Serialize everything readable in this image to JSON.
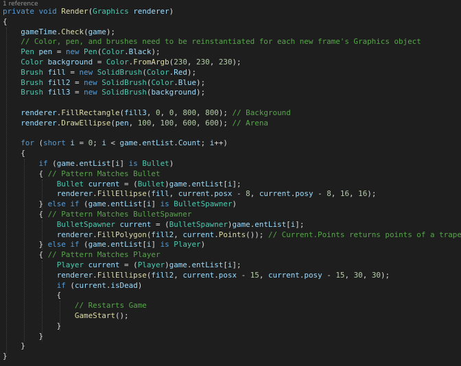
{
  "editor": {
    "codelens": "1 reference",
    "lines": [
      [
        [
          "private",
          "kw"
        ],
        [
          " ",
          "pl"
        ],
        [
          "void",
          "kw"
        ],
        [
          " ",
          "pl"
        ],
        [
          "Render",
          "fn"
        ],
        [
          "(",
          "pl"
        ],
        [
          "Graphics",
          "ty"
        ],
        [
          " ",
          "pl"
        ],
        [
          "renderer",
          "id"
        ],
        [
          ")",
          "pl"
        ]
      ],
      [
        [
          "{",
          "pl"
        ]
      ],
      [
        [
          "    ",
          "pl"
        ],
        [
          "gameTime",
          "id"
        ],
        [
          ".",
          "pl"
        ],
        [
          "Check",
          "fn"
        ],
        [
          "(",
          "pl"
        ],
        [
          "game",
          "id"
        ],
        [
          ");",
          "pl"
        ]
      ],
      [
        [
          "    ",
          "pl"
        ],
        [
          "// Color, pen, and brushes need to be reinstantiated for each new frame's Graphics object",
          "cm"
        ]
      ],
      [
        [
          "    ",
          "pl"
        ],
        [
          "Pen",
          "ty"
        ],
        [
          " ",
          "pl"
        ],
        [
          "pen",
          "id"
        ],
        [
          " = ",
          "pl"
        ],
        [
          "new",
          "kw"
        ],
        [
          " ",
          "pl"
        ],
        [
          "Pen",
          "ty"
        ],
        [
          "(",
          "pl"
        ],
        [
          "Color",
          "ty"
        ],
        [
          ".",
          "pl"
        ],
        [
          "Black",
          "id"
        ],
        [
          ");",
          "pl"
        ]
      ],
      [
        [
          "    ",
          "pl"
        ],
        [
          "Color",
          "ty"
        ],
        [
          " ",
          "pl"
        ],
        [
          "background",
          "id"
        ],
        [
          " = ",
          "pl"
        ],
        [
          "Color",
          "ty"
        ],
        [
          ".",
          "pl"
        ],
        [
          "FromArgb",
          "fn"
        ],
        [
          "(",
          "pl"
        ],
        [
          "230",
          "nm"
        ],
        [
          ", ",
          "pl"
        ],
        [
          "230",
          "nm"
        ],
        [
          ", ",
          "pl"
        ],
        [
          "230",
          "nm"
        ],
        [
          ");",
          "pl"
        ]
      ],
      [
        [
          "    ",
          "pl"
        ],
        [
          "Brush",
          "ty"
        ],
        [
          " ",
          "pl"
        ],
        [
          "fill",
          "id"
        ],
        [
          " = ",
          "pl"
        ],
        [
          "new",
          "kw"
        ],
        [
          " ",
          "pl"
        ],
        [
          "SolidBrush",
          "ty"
        ],
        [
          "(",
          "pl"
        ],
        [
          "Color",
          "ty"
        ],
        [
          ".",
          "pl"
        ],
        [
          "Red",
          "id"
        ],
        [
          ");",
          "pl"
        ]
      ],
      [
        [
          "    ",
          "pl"
        ],
        [
          "Brush",
          "ty"
        ],
        [
          " ",
          "pl"
        ],
        [
          "fill2",
          "id"
        ],
        [
          " = ",
          "pl"
        ],
        [
          "new",
          "kw"
        ],
        [
          " ",
          "pl"
        ],
        [
          "SolidBrush",
          "ty"
        ],
        [
          "(",
          "pl"
        ],
        [
          "Color",
          "ty"
        ],
        [
          ".",
          "pl"
        ],
        [
          "Blue",
          "id"
        ],
        [
          ");",
          "pl"
        ]
      ],
      [
        [
          "    ",
          "pl"
        ],
        [
          "Brush",
          "ty"
        ],
        [
          " ",
          "pl"
        ],
        [
          "fill3",
          "id"
        ],
        [
          " = ",
          "pl"
        ],
        [
          "new",
          "kw"
        ],
        [
          " ",
          "pl"
        ],
        [
          "SolidBrush",
          "ty"
        ],
        [
          "(",
          "pl"
        ],
        [
          "background",
          "id"
        ],
        [
          ");",
          "pl"
        ]
      ],
      [],
      [
        [
          "    ",
          "pl"
        ],
        [
          "renderer",
          "id"
        ],
        [
          ".",
          "pl"
        ],
        [
          "FillRectangle",
          "fn"
        ],
        [
          "(",
          "pl"
        ],
        [
          "fill3",
          "id"
        ],
        [
          ", ",
          "pl"
        ],
        [
          "0",
          "nm"
        ],
        [
          ", ",
          "pl"
        ],
        [
          "0",
          "nm"
        ],
        [
          ", ",
          "pl"
        ],
        [
          "800",
          "nm"
        ],
        [
          ", ",
          "pl"
        ],
        [
          "800",
          "nm"
        ],
        [
          "); ",
          "pl"
        ],
        [
          "// Background",
          "cm"
        ]
      ],
      [
        [
          "    ",
          "pl"
        ],
        [
          "renderer",
          "id"
        ],
        [
          ".",
          "pl"
        ],
        [
          "DrawEllipse",
          "fn"
        ],
        [
          "(",
          "pl"
        ],
        [
          "pen",
          "id"
        ],
        [
          ", ",
          "pl"
        ],
        [
          "100",
          "nm"
        ],
        [
          ", ",
          "pl"
        ],
        [
          "100",
          "nm"
        ],
        [
          ", ",
          "pl"
        ],
        [
          "600",
          "nm"
        ],
        [
          ", ",
          "pl"
        ],
        [
          "600",
          "nm"
        ],
        [
          "); ",
          "pl"
        ],
        [
          "// Arena",
          "cm"
        ]
      ],
      [],
      [
        [
          "    ",
          "pl"
        ],
        [
          "for",
          "kw"
        ],
        [
          " (",
          "pl"
        ],
        [
          "short",
          "kw"
        ],
        [
          " ",
          "pl"
        ],
        [
          "i",
          "id"
        ],
        [
          " = ",
          "pl"
        ],
        [
          "0",
          "nm"
        ],
        [
          "; ",
          "pl"
        ],
        [
          "i",
          "id"
        ],
        [
          " < ",
          "pl"
        ],
        [
          "game",
          "id"
        ],
        [
          ".",
          "pl"
        ],
        [
          "entList",
          "id"
        ],
        [
          ".",
          "pl"
        ],
        [
          "Count",
          "id"
        ],
        [
          "; ",
          "pl"
        ],
        [
          "i",
          "id"
        ],
        [
          "++)",
          "pl"
        ]
      ],
      [
        [
          "    {",
          "pl"
        ]
      ],
      [
        [
          "        ",
          "pl"
        ],
        [
          "if",
          "kw"
        ],
        [
          " (",
          "pl"
        ],
        [
          "game",
          "id"
        ],
        [
          ".",
          "pl"
        ],
        [
          "entList",
          "id"
        ],
        [
          "[",
          "pl"
        ],
        [
          "i",
          "id"
        ],
        [
          "] ",
          "pl"
        ],
        [
          "is",
          "kw"
        ],
        [
          " ",
          "pl"
        ],
        [
          "Bullet",
          "ty"
        ],
        [
          ")",
          "pl"
        ]
      ],
      [
        [
          "        { ",
          "pl"
        ],
        [
          "// Pattern Matches Bullet",
          "cm"
        ]
      ],
      [
        [
          "            ",
          "pl"
        ],
        [
          "Bullet",
          "ty"
        ],
        [
          " ",
          "pl"
        ],
        [
          "current",
          "id"
        ],
        [
          " = (",
          "pl"
        ],
        [
          "Bullet",
          "ty"
        ],
        [
          ")",
          "pl"
        ],
        [
          "game",
          "id"
        ],
        [
          ".",
          "pl"
        ],
        [
          "entList",
          "id"
        ],
        [
          "[",
          "pl"
        ],
        [
          "i",
          "id"
        ],
        [
          "];",
          "pl"
        ]
      ],
      [
        [
          "            ",
          "pl"
        ],
        [
          "renderer",
          "id"
        ],
        [
          ".",
          "pl"
        ],
        [
          "FillEllipse",
          "fn"
        ],
        [
          "(",
          "pl"
        ],
        [
          "fill",
          "id"
        ],
        [
          ", ",
          "pl"
        ],
        [
          "current",
          "id"
        ],
        [
          ".",
          "pl"
        ],
        [
          "posx",
          "id"
        ],
        [
          " - ",
          "pl"
        ],
        [
          "8",
          "nm"
        ],
        [
          ", ",
          "pl"
        ],
        [
          "current",
          "id"
        ],
        [
          ".",
          "pl"
        ],
        [
          "posy",
          "id"
        ],
        [
          " - ",
          "pl"
        ],
        [
          "8",
          "nm"
        ],
        [
          ", ",
          "pl"
        ],
        [
          "16",
          "nm"
        ],
        [
          ", ",
          "pl"
        ],
        [
          "16",
          "nm"
        ],
        [
          ");",
          "pl"
        ]
      ],
      [
        [
          "        } ",
          "pl"
        ],
        [
          "else",
          "kw"
        ],
        [
          " ",
          "pl"
        ],
        [
          "if",
          "kw"
        ],
        [
          " (",
          "pl"
        ],
        [
          "game",
          "id"
        ],
        [
          ".",
          "pl"
        ],
        [
          "entList",
          "id"
        ],
        [
          "[",
          "pl"
        ],
        [
          "i",
          "id"
        ],
        [
          "] ",
          "pl"
        ],
        [
          "is",
          "kw"
        ],
        [
          " ",
          "pl"
        ],
        [
          "BulletSpawner",
          "ty"
        ],
        [
          ")",
          "pl"
        ]
      ],
      [
        [
          "        { ",
          "pl"
        ],
        [
          "// Pattern Matches BulletSpawner",
          "cm"
        ]
      ],
      [
        [
          "            ",
          "pl"
        ],
        [
          "BulletSpawner",
          "ty"
        ],
        [
          " ",
          "pl"
        ],
        [
          "current",
          "id"
        ],
        [
          " = (",
          "pl"
        ],
        [
          "BulletSpawner",
          "ty"
        ],
        [
          ")",
          "pl"
        ],
        [
          "game",
          "id"
        ],
        [
          ".",
          "pl"
        ],
        [
          "entList",
          "id"
        ],
        [
          "[",
          "pl"
        ],
        [
          "i",
          "id"
        ],
        [
          "];",
          "pl"
        ]
      ],
      [
        [
          "            ",
          "pl"
        ],
        [
          "renderer",
          "id"
        ],
        [
          ".",
          "pl"
        ],
        [
          "FillPolygon",
          "fn"
        ],
        [
          "(",
          "pl"
        ],
        [
          "fill2",
          "id"
        ],
        [
          ", ",
          "pl"
        ],
        [
          "current",
          "id"
        ],
        [
          ".",
          "pl"
        ],
        [
          "Points",
          "fn"
        ],
        [
          "()); ",
          "pl"
        ],
        [
          "// Current.Points returns points of a trapezoid",
          "cm"
        ]
      ],
      [
        [
          "        } ",
          "pl"
        ],
        [
          "else",
          "kw"
        ],
        [
          " ",
          "pl"
        ],
        [
          "if",
          "kw"
        ],
        [
          " (",
          "pl"
        ],
        [
          "game",
          "id"
        ],
        [
          ".",
          "pl"
        ],
        [
          "entList",
          "id"
        ],
        [
          "[",
          "pl"
        ],
        [
          "i",
          "id"
        ],
        [
          "] ",
          "pl"
        ],
        [
          "is",
          "kw"
        ],
        [
          " ",
          "pl"
        ],
        [
          "Player",
          "ty"
        ],
        [
          ")",
          "pl"
        ]
      ],
      [
        [
          "        { ",
          "pl"
        ],
        [
          "// Pattern Matches Player",
          "cm"
        ]
      ],
      [
        [
          "            ",
          "pl"
        ],
        [
          "Player",
          "ty"
        ],
        [
          " ",
          "pl"
        ],
        [
          "current",
          "id"
        ],
        [
          " = (",
          "pl"
        ],
        [
          "Player",
          "ty"
        ],
        [
          ")",
          "pl"
        ],
        [
          "game",
          "id"
        ],
        [
          ".",
          "pl"
        ],
        [
          "entList",
          "id"
        ],
        [
          "[",
          "pl"
        ],
        [
          "i",
          "id"
        ],
        [
          "];",
          "pl"
        ]
      ],
      [
        [
          "            ",
          "pl"
        ],
        [
          "renderer",
          "id"
        ],
        [
          ".",
          "pl"
        ],
        [
          "FillEllipse",
          "fn"
        ],
        [
          "(",
          "pl"
        ],
        [
          "fill2",
          "id"
        ],
        [
          ", ",
          "pl"
        ],
        [
          "current",
          "id"
        ],
        [
          ".",
          "pl"
        ],
        [
          "posx",
          "id"
        ],
        [
          " - ",
          "pl"
        ],
        [
          "15",
          "nm"
        ],
        [
          ", ",
          "pl"
        ],
        [
          "current",
          "id"
        ],
        [
          ".",
          "pl"
        ],
        [
          "posy",
          "id"
        ],
        [
          " - ",
          "pl"
        ],
        [
          "15",
          "nm"
        ],
        [
          ", ",
          "pl"
        ],
        [
          "30",
          "nm"
        ],
        [
          ", ",
          "pl"
        ],
        [
          "30",
          "nm"
        ],
        [
          ");",
          "pl"
        ]
      ],
      [
        [
          "            ",
          "pl"
        ],
        [
          "if",
          "kw"
        ],
        [
          " (",
          "pl"
        ],
        [
          "current",
          "id"
        ],
        [
          ".",
          "pl"
        ],
        [
          "isDead",
          "id"
        ],
        [
          ")",
          "pl"
        ]
      ],
      [
        [
          "            {",
          "pl"
        ]
      ],
      [
        [
          "                ",
          "pl"
        ],
        [
          "// Restarts Game",
          "cm"
        ]
      ],
      [
        [
          "                ",
          "pl"
        ],
        [
          "GameStart",
          "fn"
        ],
        [
          "();",
          "pl"
        ]
      ],
      [
        [
          "            }",
          "pl"
        ]
      ],
      [
        [
          "        }",
          "pl"
        ]
      ],
      [
        [
          "    }",
          "pl"
        ]
      ],
      [
        [
          "}",
          "pl"
        ]
      ]
    ]
  },
  "colors": {
    "background": "#1e1e1e",
    "keyword": "#569cd6",
    "type": "#4ec9b0",
    "method": "#dcdcaa",
    "identifier": "#9cdcfe",
    "comment": "#57a64a",
    "number": "#b5cea8",
    "punctuation": "#dcdcdc"
  }
}
